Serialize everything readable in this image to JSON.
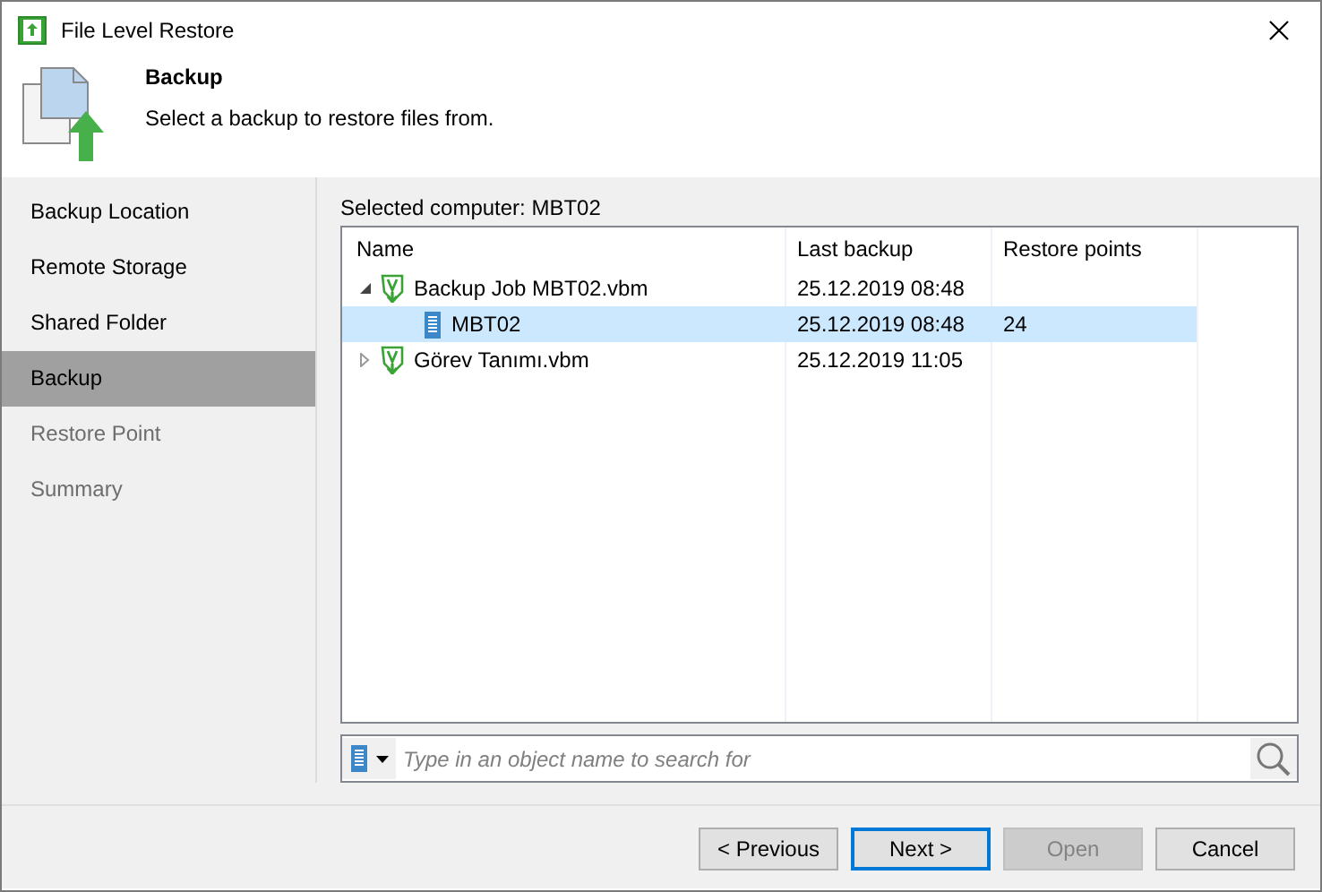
{
  "window": {
    "title": "File Level Restore"
  },
  "header": {
    "title": "Backup",
    "subtitle": "Select a backup to restore files from."
  },
  "steps": [
    {
      "label": "Backup Location",
      "selected": false,
      "disabled": false
    },
    {
      "label": "Remote Storage",
      "selected": false,
      "disabled": false
    },
    {
      "label": "Shared Folder",
      "selected": false,
      "disabled": false
    },
    {
      "label": "Backup",
      "selected": true,
      "disabled": false
    },
    {
      "label": "Restore Point",
      "selected": false,
      "disabled": true
    },
    {
      "label": "Summary",
      "selected": false,
      "disabled": true
    }
  ],
  "selected_computer": "Selected computer: MBT02",
  "table": {
    "columns": [
      "Name",
      "Last backup",
      "Restore points"
    ],
    "rows": [
      {
        "kind": "job",
        "name": "Backup Job MBT02.vbm",
        "last_backup": "25.12.2019 08:48",
        "expanded": true,
        "selected": false,
        "children": [
          {
            "kind": "machine",
            "name": "MBT02",
            "last_backup": "25.12.2019 08:48",
            "restore_points": "24",
            "selected": true
          }
        ]
      },
      {
        "kind": "job",
        "name": "Görev Tanımı.vbm",
        "last_backup": "25.12.2019 11:05",
        "expanded": false,
        "selected": false
      }
    ]
  },
  "search": {
    "placeholder": "Type in an object name to search for"
  },
  "buttons": [
    {
      "label": "< Previous",
      "disabled": false,
      "default": false
    },
    {
      "label": "Next >",
      "disabled": false,
      "default": true
    },
    {
      "label": "Open",
      "disabled": true,
      "default": false
    },
    {
      "label": "Cancel",
      "disabled": false,
      "default": false
    }
  ]
}
